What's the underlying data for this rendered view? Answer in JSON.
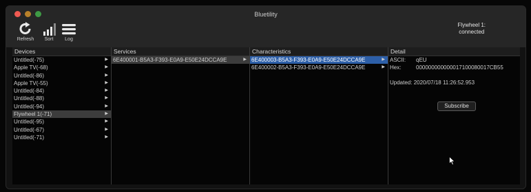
{
  "window": {
    "title": "Bluetility"
  },
  "toolbar": [
    {
      "label": "Refresh",
      "icon": "refresh-icon"
    },
    {
      "label": "Sort",
      "icon": "sort-signal-icon"
    },
    {
      "label": "Log",
      "icon": "log-menu-icon"
    }
  ],
  "status": {
    "device": "Flywheel 1:",
    "state": "connected"
  },
  "devices": {
    "header": "Devices",
    "items": [
      "Untitled(-75)",
      "Apple TV(-68)",
      "Untitled(-86)",
      "Apple TV(-55)",
      "Untitled(-84)",
      "Untitled(-88)",
      "Untitled(-94)",
      "Flywheel 1(-71)",
      "Untitled(-95)",
      "Untitled(-67)",
      "Untitled(-71)"
    ],
    "selected_index": 7
  },
  "services": {
    "header": "Services",
    "items": [
      "6E400001-B5A3-F393-E0A9-E50E24DCCA9E"
    ],
    "selected_index": 0
  },
  "characteristics": {
    "header": "Characteristics",
    "items": [
      "6E400003-B5A3-F393-E0A9-E50E24DCCA9E",
      "6E400002-B5A3-F393-E0A9-E50E24DCCA9E"
    ],
    "selected_index": 0
  },
  "detail": {
    "header": "Detail",
    "ascii_label": "ASCII:",
    "ascii_value": "qEU",
    "hex_label": "Hex:",
    "hex_value": "000000000000017100080017CB55",
    "updated": "Updated: 2020/07/18 11:26:52.953",
    "subscribe_label": "Subscribe"
  },
  "colors": {
    "selection_blue": "#2d5fa8",
    "selection_gray": "#3c3c3c"
  }
}
